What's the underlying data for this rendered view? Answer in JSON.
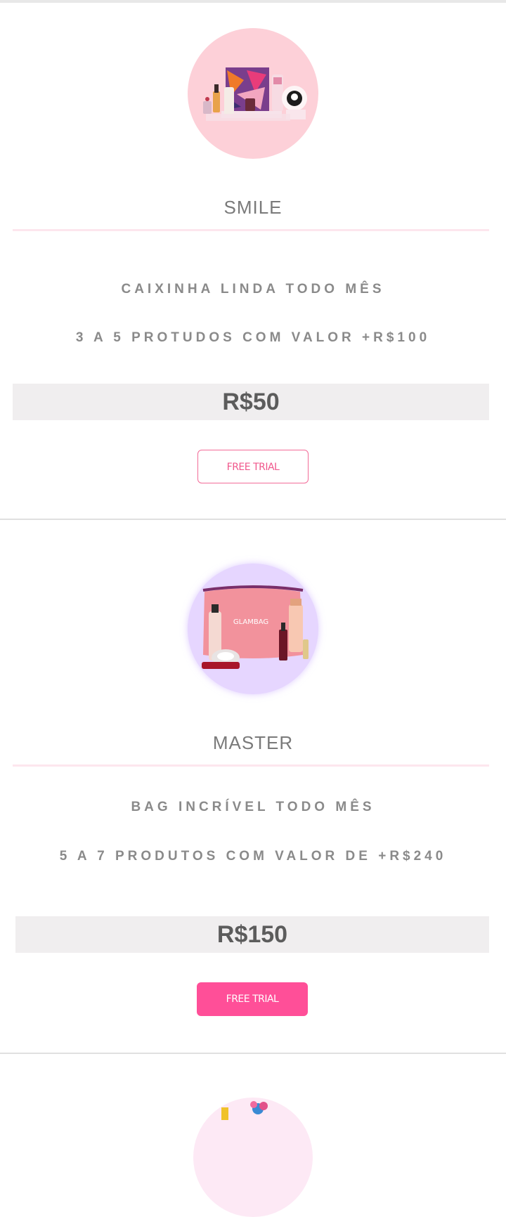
{
  "plans": [
    {
      "name": "SMILE",
      "features": [
        "CAIXINHA LINDA TODO MÊS",
        "3 A 5 PROTUDOS COM VALOR +R$100"
      ],
      "price": "R$50",
      "button_label": "FREE TRIAL",
      "image": "beauty-box-products-image",
      "circle_color": "#fdd0d8"
    },
    {
      "name": "MASTER",
      "features": [
        "BAG INCRÍVEL TODO MÊS",
        "5 A 7 PRODUTOS COM VALOR DE +R$240"
      ],
      "price": "R$150",
      "button_label": "FREE TRIAL",
      "image": "glambag-products-image",
      "circle_color": "#e6d6ff",
      "bag_text": "GLAMBAG"
    },
    {
      "image": "gift-products-image",
      "circle_color": "#fde9f5"
    }
  ],
  "colors": {
    "accent": "#ff4f98",
    "outline_button": "#f36b98",
    "price_bg": "#f0eeef",
    "divider": "#fde6ee"
  }
}
